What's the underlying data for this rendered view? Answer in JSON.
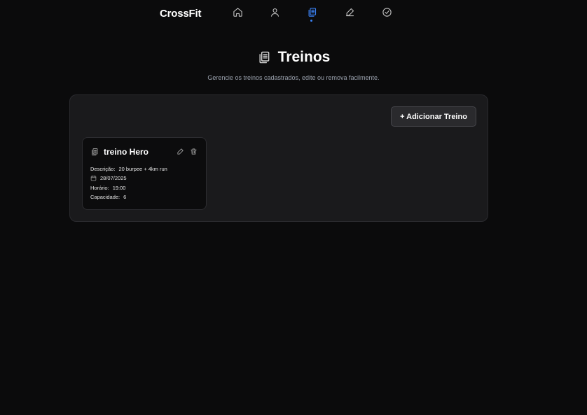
{
  "topbar": {
    "brand": "CrossFit",
    "nav": [
      {
        "icon": "home-icon"
      },
      {
        "icon": "user-icon"
      },
      {
        "icon": "clipboard-icon",
        "active": true
      },
      {
        "icon": "edit-icon"
      },
      {
        "icon": "check-circle-icon"
      }
    ],
    "accent": "#3b82f6"
  },
  "hero": {
    "title": "Treinos",
    "subtitle": "Gerencie os treinos cadastrados, edite ou remova facilmente."
  },
  "panel": {
    "add_button": "+ Adicionar Treino",
    "cards": [
      {
        "title": "treino Hero",
        "description_label": "Descrição:",
        "description": "20 burpee + 4km run",
        "date": "28/07/2025",
        "time_label": "Horário:",
        "time": "19:00",
        "capacity_label": "Capacidade:",
        "capacity": "6"
      }
    ]
  }
}
